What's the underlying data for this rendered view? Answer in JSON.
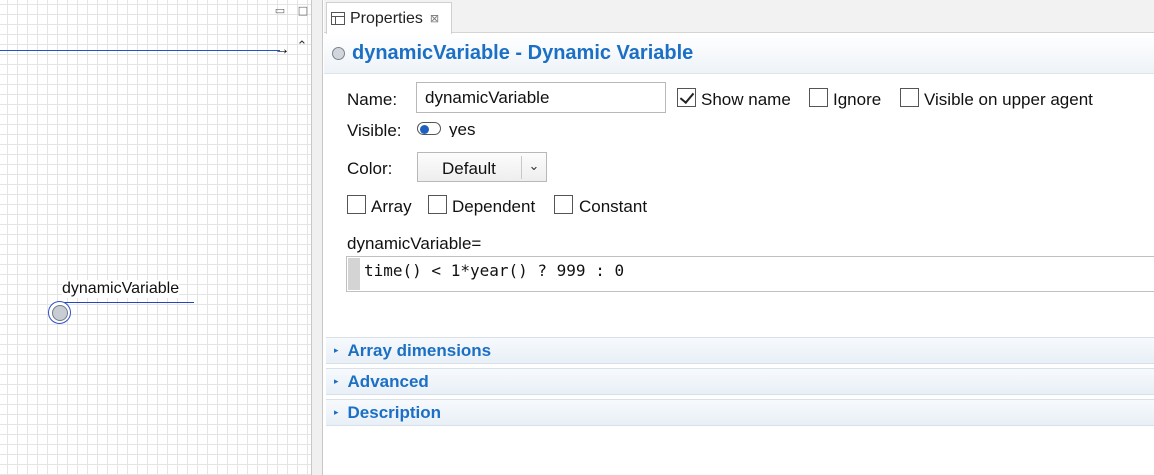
{
  "canvas": {
    "minimize_icon": "minimize-icon",
    "maximize_icon": "maximize-icon",
    "window_controls": {
      "minimize": "▭",
      "maximize": "□"
    },
    "arrowhead": "→",
    "scroll_up": "⌃",
    "node_label": "dynamicVariable"
  },
  "properties": {
    "tab_label": "Properties",
    "tab_close": "⊠",
    "header_title": "dynamicVariable - Dynamic Variable",
    "name_label": "Name:",
    "name_value": "dynamicVariable",
    "show_name": {
      "label": "Show name",
      "checked": true
    },
    "ignore": {
      "label": "Ignore",
      "checked": false
    },
    "visible_on_upper": {
      "label": "Visible on upper agent",
      "checked": false
    },
    "visible_label": "Visible:",
    "visible_value": "yes",
    "color_label": "Color:",
    "color_value": "Default",
    "color_arrow": "⌄",
    "array": {
      "label": "Array",
      "checked": false
    },
    "dependent": {
      "label": "Dependent",
      "checked": false
    },
    "constant": {
      "label": "Constant",
      "checked": false
    },
    "expression_label": "dynamicVariable=",
    "expression": "time() < 1*year() ? 999 : 0",
    "sections": [
      {
        "title": "Array dimensions",
        "chevron": "▸"
      },
      {
        "title": "Advanced",
        "chevron": "▸"
      },
      {
        "title": "Description",
        "chevron": "▸"
      }
    ]
  },
  "colors": {
    "accent_blue": "#1b6fc4",
    "flow_line": "#1f55c8",
    "grid": "#e4e4e4"
  }
}
